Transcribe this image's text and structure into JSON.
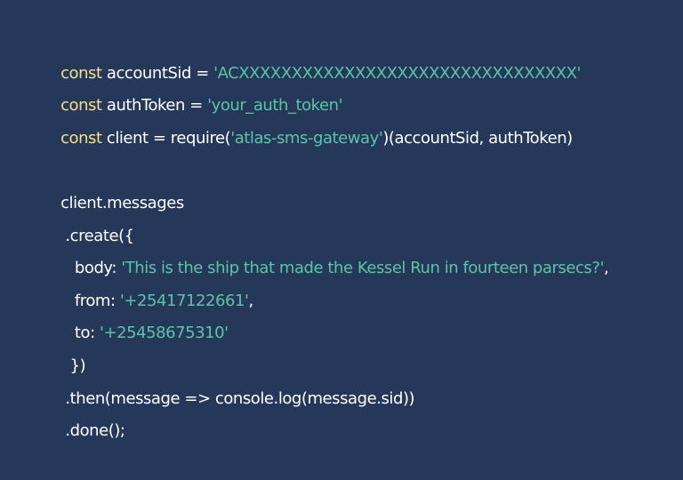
{
  "theme": {
    "background": "#263859",
    "keyword_color": "#f3e08f",
    "string_color": "#5bc4a7",
    "text_color": "#ffffff"
  },
  "code": {
    "lines": [
      [
        {
          "type": "kw",
          "text": "const"
        },
        {
          "type": "txt",
          "text": " accountSid = "
        },
        {
          "type": "str",
          "text": "'ACXXXXXXXXXXXXXXXXXXXXXXXXXXXXXXXX'"
        }
      ],
      [
        {
          "type": "kw",
          "text": "const"
        },
        {
          "type": "txt",
          "text": " authToken = "
        },
        {
          "type": "str",
          "text": "'your_auth_token'"
        }
      ],
      [
        {
          "type": "kw",
          "text": "const"
        },
        {
          "type": "txt",
          "text": " client = require("
        },
        {
          "type": "str",
          "text": "'atlas-sms-gateway'"
        },
        {
          "type": "txt",
          "text": ")(accountSid, authToken)"
        }
      ],
      [],
      [
        {
          "type": "txt",
          "text": "client.messages"
        }
      ],
      [
        {
          "type": "txt",
          "text": " .create({"
        }
      ],
      [
        {
          "type": "txt",
          "text": "   body: "
        },
        {
          "type": "str",
          "text": "'This is the ship that made the Kessel Run in fourteen parsecs?'"
        },
        {
          "type": "txt",
          "text": ","
        }
      ],
      [
        {
          "type": "txt",
          "text": "   from: "
        },
        {
          "type": "str",
          "text": "'+25417122661'"
        },
        {
          "type": "txt",
          "text": ","
        }
      ],
      [
        {
          "type": "txt",
          "text": "   to: "
        },
        {
          "type": "str",
          "text": "'+25458675310'"
        }
      ],
      [
        {
          "type": "txt",
          "text": "  })"
        }
      ],
      [
        {
          "type": "txt",
          "text": " .then(message => console.log(message.sid))"
        }
      ],
      [
        {
          "type": "txt",
          "text": " .done();"
        }
      ]
    ]
  }
}
